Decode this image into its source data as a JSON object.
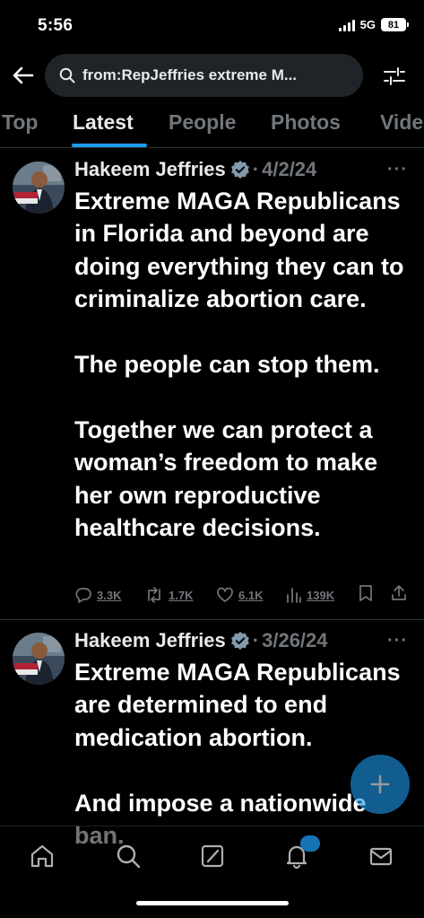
{
  "status_bar": {
    "time": "5:56",
    "network": "5G",
    "battery": "81"
  },
  "search": {
    "query": "from:RepJeffries extreme M..."
  },
  "tabs": [
    {
      "label": "Top"
    },
    {
      "label": "Latest"
    },
    {
      "label": "People"
    },
    {
      "label": "Photos"
    },
    {
      "label": "Vide"
    }
  ],
  "tweets": [
    {
      "author": "Hakeem Jeffries",
      "date": "4/2/24",
      "text": "Extreme MAGA Republicans in Florida and beyond are doing everything they can to criminalize abortion care.\n\nThe people can stop them.\n\nTogether we can protect a woman’s freedom to make her own reproductive healthcare decisions.",
      "replies": "3.3K",
      "reposts": "1.7K",
      "likes": "6.1K",
      "views": "139K"
    },
    {
      "author": "Hakeem Jeffries",
      "date": "3/26/24",
      "text": "Extreme MAGA Republicans are determined to end medication abortion.\n\nAnd impose a nationwide ban."
    }
  ],
  "nav": {
    "notifications_badge": ""
  },
  "colors": {
    "accent": "#1d9bf0",
    "muted": "#71767b",
    "background": "#000000",
    "divider": "#2f3336"
  }
}
